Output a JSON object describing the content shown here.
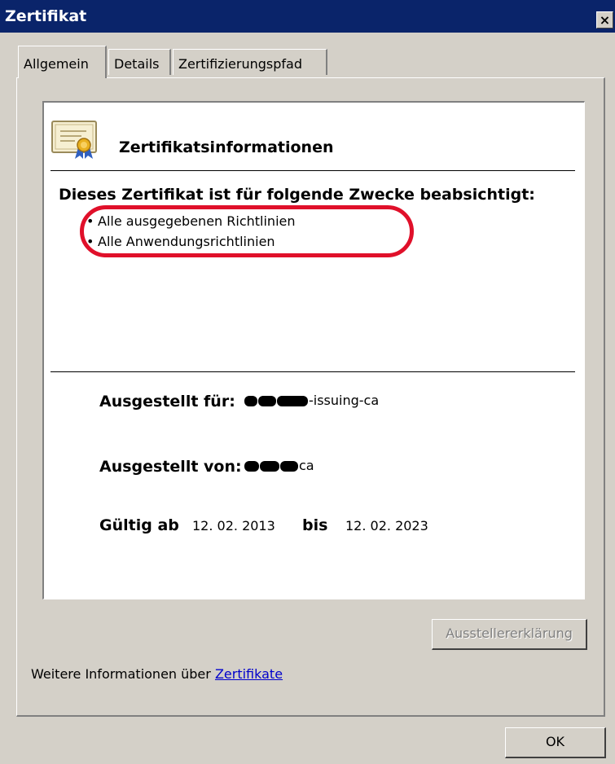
{
  "window": {
    "title": "Zertifikat",
    "close_label": "×"
  },
  "tabs": [
    {
      "label": "Allgemein",
      "active": true
    },
    {
      "label": "Details",
      "active": false
    },
    {
      "label": "Zertifizierungspfad",
      "active": false
    }
  ],
  "certificate_info": {
    "icon": "certificate-icon",
    "heading": "Zertifikatsinformationen",
    "purpose_title": "Dieses Zertifikat ist für folgende Zwecke beabsichtigt:",
    "purposes": [
      "Alle ausgegebenen Richtlinien",
      "Alle Anwendungsrichtlinien"
    ],
    "issued_to_label": "Ausgestellt für:",
    "issued_to_value": "-issuing-ca",
    "issued_by_label": "Ausgestellt von:",
    "issued_by_value": "ca",
    "valid_from_label": "Gültig ab",
    "valid_from": "12. 02. 2013",
    "valid_to_label": "bis",
    "valid_to": "12. 02. 2023"
  },
  "issuer_statement_button": {
    "label": "Ausstellererklärung",
    "enabled": false
  },
  "more_info": {
    "text": "Weitere Informationen über",
    "link": "Zertifikate"
  },
  "ok_button": {
    "label": "OK"
  },
  "colors": {
    "titlebar": "#0a246a",
    "dialog_bg": "#d4d0c8",
    "highlight": "#e0102a",
    "link": "#0000cc"
  }
}
